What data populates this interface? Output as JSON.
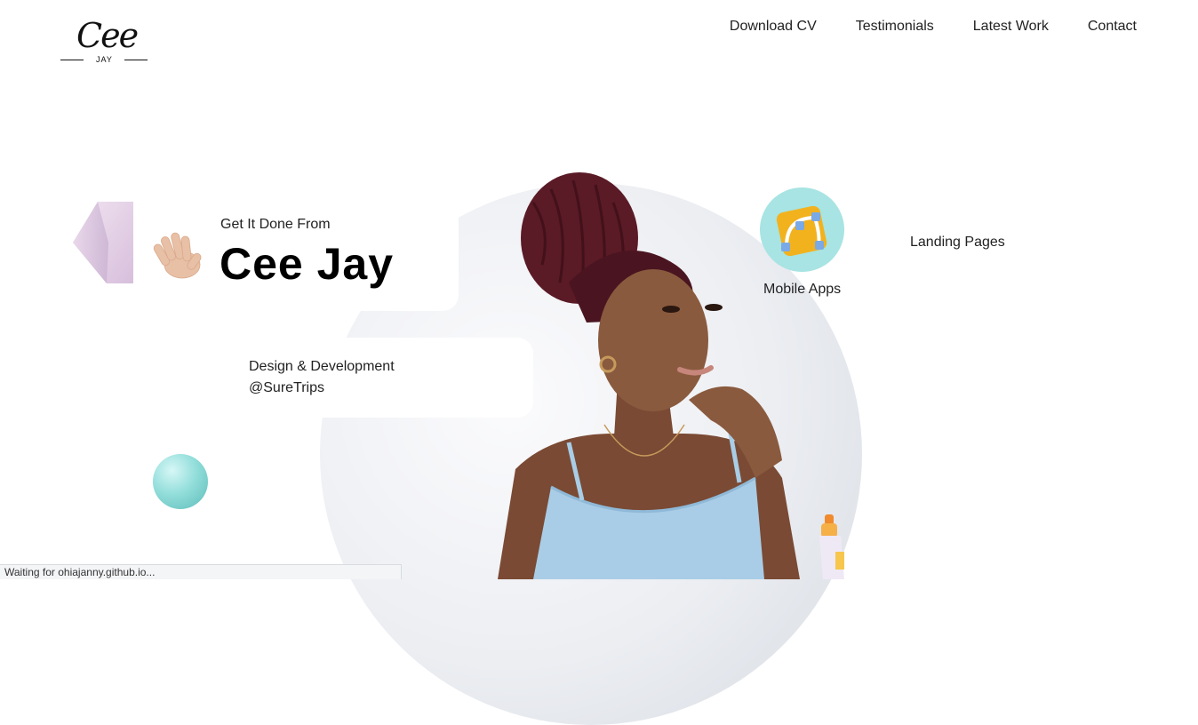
{
  "logo": {
    "script": "Cee",
    "sub": "JAY"
  },
  "nav": {
    "items": [
      {
        "label": "Download CV"
      },
      {
        "label": "Testimonials"
      },
      {
        "label": "Latest Work"
      },
      {
        "label": "Contact"
      }
    ]
  },
  "hero": {
    "greeting": "Get It Done From",
    "name": "Cee Jay",
    "role_line1": "Design & Development",
    "role_line2": "@SureTrips"
  },
  "services": {
    "mobile": "Mobile Apps",
    "landing": "Landing Pages"
  },
  "status_bar": {
    "text": "Waiting for ohiajanny.github.io..."
  },
  "colors": {
    "accent_teal": "#a7e4e3",
    "text": "#222222",
    "hair": "#5a1a26",
    "top": "#a9cde6"
  }
}
